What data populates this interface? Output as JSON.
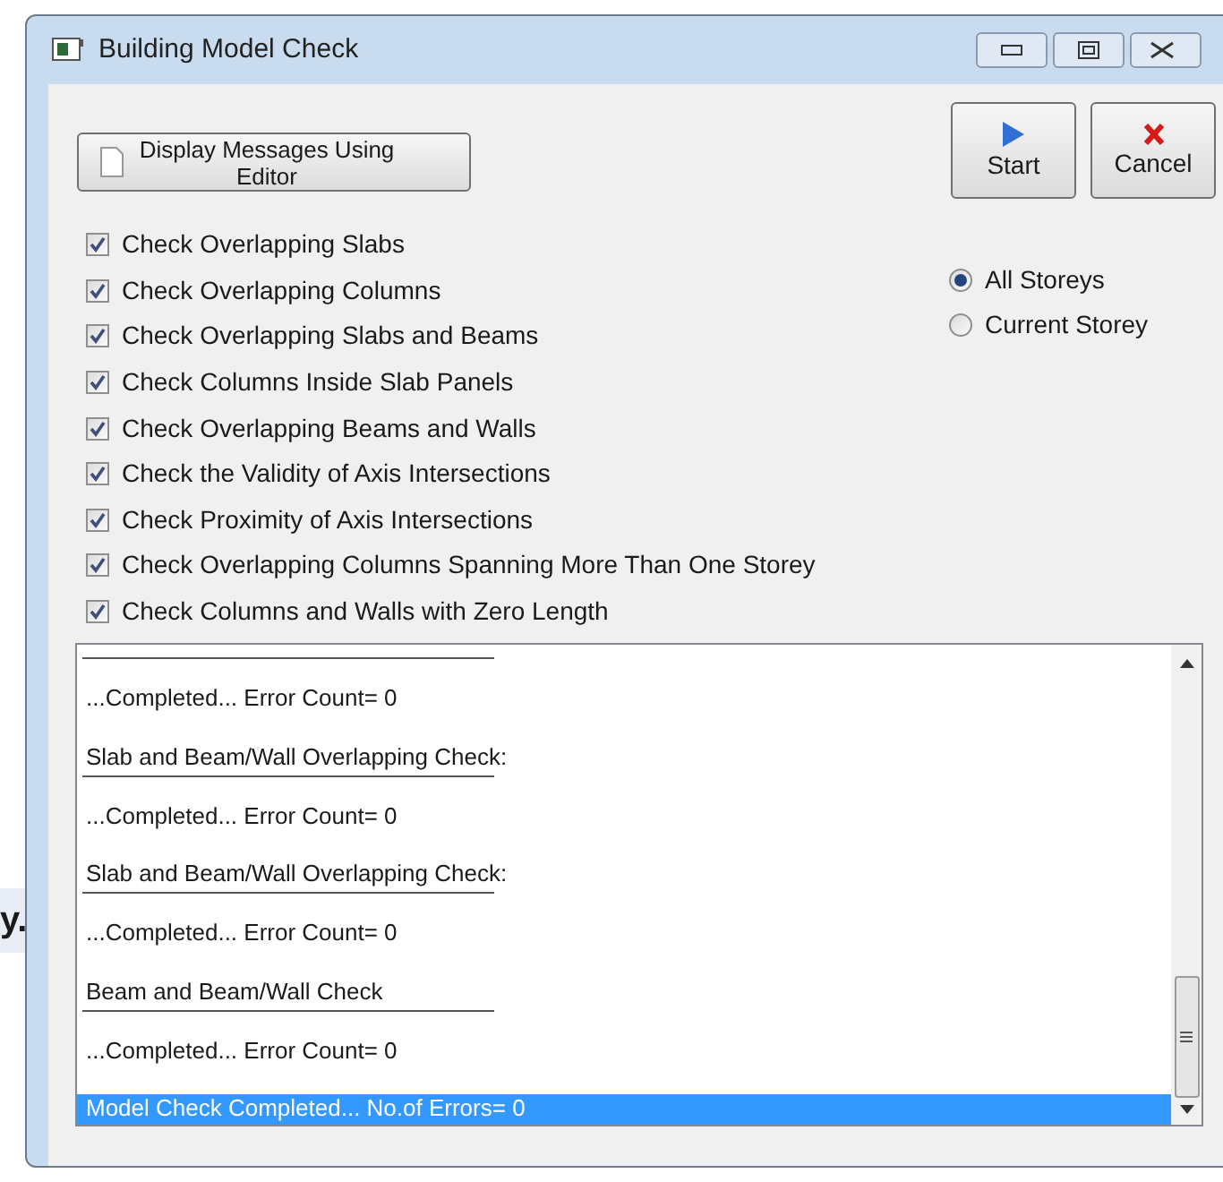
{
  "background_text": "y.",
  "window": {
    "title": "Building Model Check"
  },
  "display_button": {
    "label": "Display Messages Using Editor"
  },
  "action_buttons": [
    {
      "kind": "start",
      "label": "Start"
    },
    {
      "kind": "cancel",
      "label": "Cancel"
    }
  ],
  "checks": [
    {
      "label": "Check Overlapping Slabs",
      "checked": true
    },
    {
      "label": "Check Overlapping Columns",
      "checked": true
    },
    {
      "label": "Check Overlapping Slabs and Beams",
      "checked": true
    },
    {
      "label": "Check Columns Inside Slab Panels",
      "checked": true
    },
    {
      "label": "Check Overlapping Beams and Walls",
      "checked": true
    },
    {
      "label": "Check the Validity of Axis Intersections",
      "checked": true
    },
    {
      "label": "Check Proximity of Axis Intersections",
      "checked": true
    },
    {
      "label": "Check Overlapping Columns Spanning More Than One Storey",
      "checked": true
    },
    {
      "label": "Check Columns and Walls with Zero Length",
      "checked": true
    }
  ],
  "storey_options": [
    {
      "label": "All Storeys",
      "selected": true
    },
    {
      "label": "Current Storey",
      "selected": false
    }
  ],
  "messages": [
    {
      "kind": "separator"
    },
    {
      "kind": "text",
      "text": "...Completed... Error Count= 0",
      "selected": false
    },
    {
      "kind": "blank"
    },
    {
      "kind": "text",
      "text": "Slab and Beam/Wall Overlapping Check:",
      "selected": false
    },
    {
      "kind": "separator"
    },
    {
      "kind": "text",
      "text": "...Completed... Error Count= 0",
      "selected": false
    },
    {
      "kind": "blank"
    },
    {
      "kind": "text",
      "text": "Slab and Beam/Wall Overlapping Check:",
      "selected": false
    },
    {
      "kind": "separator"
    },
    {
      "kind": "text",
      "text": "...Completed... Error Count= 0",
      "selected": false
    },
    {
      "kind": "blank"
    },
    {
      "kind": "text",
      "text": "Beam and Beam/Wall Check",
      "selected": false
    },
    {
      "kind": "separator"
    },
    {
      "kind": "text",
      "text": "...Completed... Error Count= 0",
      "selected": false
    },
    {
      "kind": "blank"
    },
    {
      "kind": "text",
      "text": "Model Check Completed... No.of Errors= 0",
      "selected": true
    }
  ]
}
